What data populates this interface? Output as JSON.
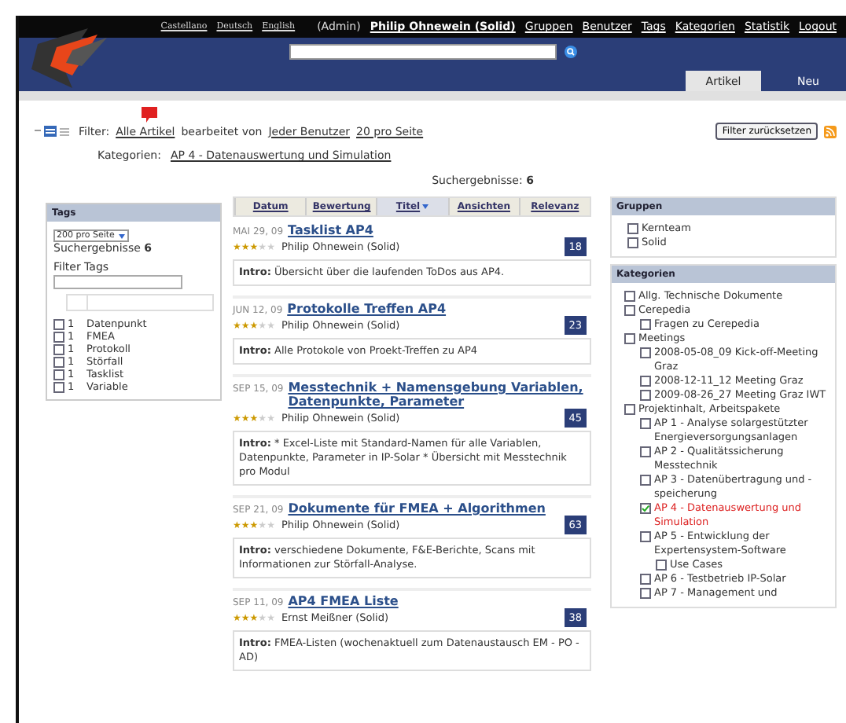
{
  "header": {
    "languages": [
      "Castellano",
      "Deutsch",
      "English"
    ],
    "role": "(Admin)",
    "user": "Philip Ohnewein (Solid)",
    "nav": [
      "Gruppen",
      "Benutzer",
      "Tags",
      "Kategorien",
      "Statistik",
      "Logout"
    ],
    "tabs": [
      {
        "label": "Artikel",
        "selected": true
      },
      {
        "label": "Neu",
        "selected": false
      }
    ]
  },
  "filter": {
    "label": "Filter:",
    "articles": "Alle Artikel",
    "edited_by": "bearbeitet von",
    "user": "Jeder Benutzer",
    "per_page": "20 pro Seite",
    "reset": "Filter zurücksetzen",
    "categories_label": "Kategorien:",
    "category": "AP 4 - Datenauswertung und Simulation",
    "results": "Suchergebnisse: **6**"
  },
  "tags": {
    "title": "Tags",
    "per_page": "200 pro Seite",
    "results": "Suchergebnisse **6**",
    "filter_label": "Filter Tags",
    "items": [
      {
        "count": "1",
        "name": "Datenpunkt",
        "checked": false
      },
      {
        "count": "1",
        "name": "FMEA",
        "checked": false
      },
      {
        "count": "1",
        "name": "Protokoll",
        "checked": false
      },
      {
        "count": "1",
        "name": "Störfall",
        "checked": false
      },
      {
        "count": "1",
        "name": "Tasklist",
        "checked": false
      },
      {
        "count": "1",
        "name": "Variable",
        "checked": false
      }
    ]
  },
  "sort": [
    {
      "label": "Datum",
      "selected": false
    },
    {
      "label": "Bewertung",
      "selected": false
    },
    {
      "label": "Titel",
      "selected": true
    },
    {
      "label": "Ansichten",
      "selected": false
    },
    {
      "label": "Relevanz",
      "selected": false
    }
  ],
  "articles": [
    {
      "date": "MAI 29, 09",
      "title": "Tasklist AP4",
      "stars": 3,
      "author": "Philip Ohnewein (Solid)",
      "views": "18",
      "intro": "**Intro:** Übersicht über die laufenden ToDos aus AP4."
    },
    {
      "date": "JUN 12, 09",
      "title": "Protokolle Treffen AP4",
      "stars": 3,
      "author": "Philip Ohnewein (Solid)",
      "views": "23",
      "intro": "**Intro:** Alle Protokole von Proekt-Treffen zu AP4"
    },
    {
      "date": "SEP 15, 09",
      "title": "Messtechnik + Namensgebung Variablen, Datenpunkte, Parameter",
      "stars": 3,
      "author": "Philip Ohnewein (Solid)",
      "views": "45",
      "intro": "**Intro:** * Excel-Liste mit Standard-Namen für alle Variablen, Datenpunkte, Parameter in IP-Solar * Übersicht mit Messtechnik pro Modul"
    },
    {
      "date": "SEP 21, 09",
      "title": "Dokumente für FMEA + Algorithmen",
      "stars": 3,
      "author": "Philip Ohnewein (Solid)",
      "views": "63",
      "intro": "**Intro:** verschiedene Dokumente, F&E-Berichte, Scans mit Informationen zur Störfall-Analyse."
    },
    {
      "date": "SEP 11, 09",
      "title": "AP4 FMEA Liste",
      "stars": 3,
      "author": "Ernst Meißner (Solid)",
      "views": "38",
      "intro": "**Intro:** FMEA-Listen (wochenaktuell zum Datenaustausch EM - PO - AD)"
    }
  ],
  "groups": {
    "title": "Gruppen",
    "items": [
      {
        "name": "Kernteam",
        "checked": false
      },
      {
        "name": "Solid",
        "checked": false
      }
    ]
  },
  "categories": {
    "title": "Kategorien",
    "items": [
      {
        "name": "Allg. Technische Dokumente",
        "checked": false
      },
      {
        "name": "Cerepedia",
        "checked": false,
        "children": [
          {
            "name": "Fragen zu Cerepedia",
            "checked": false
          }
        ]
      },
      {
        "name": "Meetings",
        "checked": false,
        "children": [
          {
            "name": "2008-05-08_09 Kick-off-Meeting Graz",
            "checked": false
          },
          {
            "name": "2008-12-11_12 Meeting Graz",
            "checked": false
          },
          {
            "name": "2009-08-26_27 Meeting Graz IWT",
            "checked": false
          }
        ]
      },
      {
        "name": "Projektinhalt, Arbeitspakete",
        "checked": false,
        "children": [
          {
            "name": "AP 1 - Analyse solargestützter Energieversorgungsanlagen",
            "checked": false
          },
          {
            "name": "AP 2 - Qualitätssicherung Messtechnik",
            "checked": false
          },
          {
            "name": "AP 3 - Datenübertragung und -speicherung",
            "checked": false
          },
          {
            "name": "AP 4 - Datenauswertung und Simulation",
            "checked": true
          },
          {
            "name": "AP 5 - Entwicklung der Expertensystem-Software",
            "checked": false,
            "children": [
              {
                "name": "Use Cases",
                "checked": false
              }
            ]
          },
          {
            "name": "AP 6 - Testbetrieb IP-Solar",
            "checked": false
          },
          {
            "name": "AP 7 - Management und",
            "checked": false
          }
        ]
      }
    ]
  }
}
